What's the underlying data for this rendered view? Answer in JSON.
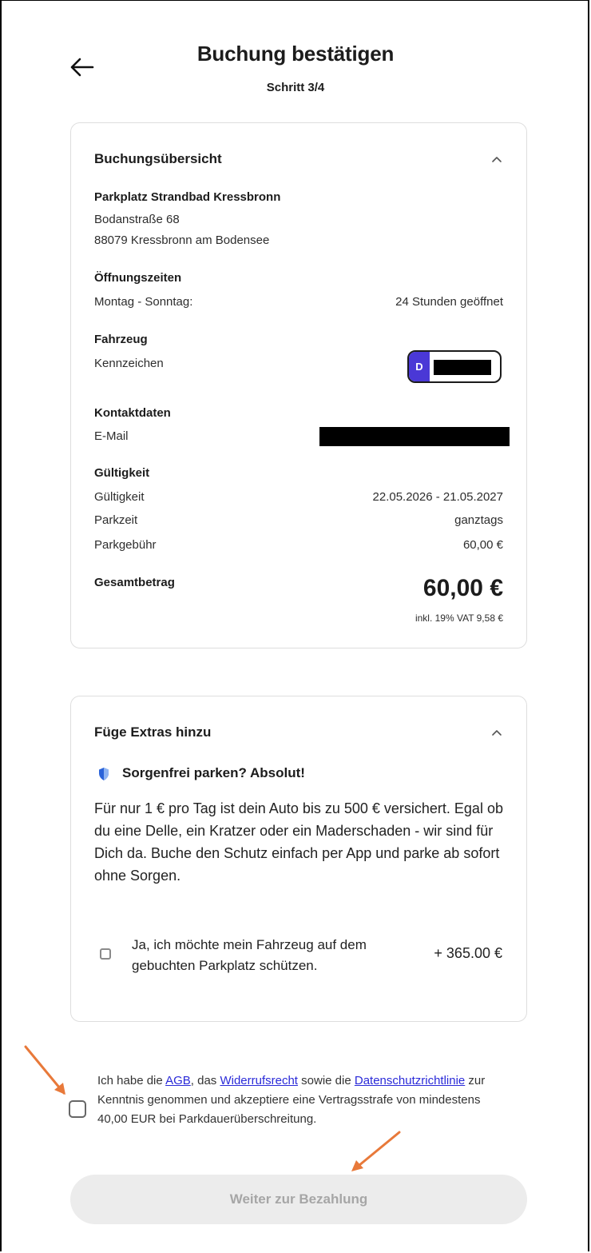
{
  "header": {
    "title": "Buchung bestätigen",
    "step": "Schritt 3/4"
  },
  "summary": {
    "title": "Buchungsübersicht",
    "location": {
      "name": "Parkplatz Strandbad Kressbronn",
      "street": "Bodanstraße 68",
      "city": "88079 Kressbronn am Bodensee"
    },
    "hours": {
      "heading": "Öffnungszeiten",
      "days": "Montag - Sonntag:",
      "value": "24 Stunden geöffnet"
    },
    "vehicle": {
      "heading": "Fahrzeug",
      "label": "Kennzeichen",
      "country": "D"
    },
    "contact": {
      "heading": "Kontaktdaten",
      "label": "E-Mail"
    },
    "validity": {
      "heading": "Gültigkeit",
      "rows": [
        {
          "label": "Gültigkeit",
          "value": "22.05.2026 - 21.05.2027"
        },
        {
          "label": "Parkzeit",
          "value": "ganztags"
        },
        {
          "label": "Parkgebühr",
          "value": "60,00 €"
        }
      ]
    },
    "total": {
      "label": "Gesamtbetrag",
      "value": "60,00 €",
      "vat": "inkl. 19% VAT 9,58 €"
    }
  },
  "extras": {
    "title": "Füge Extras hinzu",
    "subtitle": "Sorgenfrei parken? Absolut!",
    "body": "Für nur 1 € pro Tag ist dein Auto bis zu 500 € versichert. Egal ob du eine Delle, ein Kratzer oder ein Maderschaden - wir sind für Dich da. Buche den Schutz einfach per App und parke ab sofort ohne Sorgen.",
    "option_label": "Ja, ich möchte mein Fahrzeug auf dem gebuchten Parkplatz schützen.",
    "option_price": "+ 365.00 €"
  },
  "terms": {
    "t1": "Ich habe die ",
    "agb": "AGB",
    "t2": ", das ",
    "widerruf": "Widerrufsrecht",
    "t3": " sowie die ",
    "datenschutz": "Datenschutzrichtlinie",
    "t4": " zur Kenntnis genommen und akzeptiere eine Vertragsstrafe von mindestens 40,00 EUR bei Parkdauerüberschreitung."
  },
  "cta": {
    "label": "Weiter zur Bezahlung"
  },
  "colors": {
    "accent": "#4a38d6",
    "annotation": "#e8793a",
    "link": "#2a2ad8"
  }
}
